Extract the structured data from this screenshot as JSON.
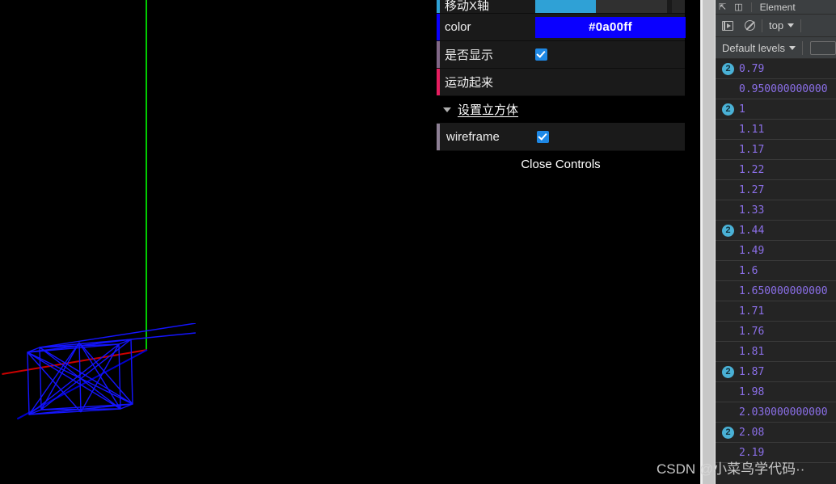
{
  "scene": {
    "background_color": "#000000",
    "axis_x_color": "#cc0000",
    "axis_y_color": "#00cc00",
    "axis_z_color": "#0000cc",
    "cube_wireframe_color": "#1414ff"
  },
  "gui": {
    "rows": [
      {
        "label": "移动X轴",
        "type": "slider",
        "value": "2.14",
        "fill_percent": 46,
        "marker_color": "#2fa1d6"
      },
      {
        "label": "color",
        "type": "color",
        "value": "#0a00ff",
        "marker_color": "#0a00ff"
      },
      {
        "label": "是否显示",
        "type": "checkbox",
        "checked": true,
        "marker_color": "#806787"
      },
      {
        "label": "运动起来",
        "type": "button",
        "marker_color": "#e61d5f"
      }
    ],
    "folder": {
      "title": "设置立方体",
      "expanded": true,
      "rows": [
        {
          "label": "wireframe",
          "type": "checkbox",
          "checked": true,
          "marker_color": "#8d7f94"
        }
      ]
    },
    "close_label": "Close Controls"
  },
  "devtools": {
    "tabbar": {
      "cursor_icon": "inspect-element-icon",
      "device_icon": "device-toolbar-icon",
      "tab_label": "Element"
    },
    "toolbar": {
      "sidebar_icon": "console-sidebar-icon",
      "clear_icon": "clear-console-icon",
      "context_value": "top"
    },
    "filterbar": {
      "levels_value": "Default levels",
      "filter_value": "",
      "filter_placeholder": ""
    },
    "console_entries": [
      {
        "count": "2",
        "value": "0.79"
      },
      {
        "count": "",
        "value": "0.950000000000"
      },
      {
        "count": "2",
        "value": "1"
      },
      {
        "count": "",
        "value": "1.11"
      },
      {
        "count": "",
        "value": "1.17"
      },
      {
        "count": "",
        "value": "1.22"
      },
      {
        "count": "",
        "value": "1.27"
      },
      {
        "count": "",
        "value": "1.33"
      },
      {
        "count": "2",
        "value": "1.44"
      },
      {
        "count": "",
        "value": "1.49"
      },
      {
        "count": "",
        "value": "1.6"
      },
      {
        "count": "",
        "value": "1.650000000000"
      },
      {
        "count": "",
        "value": "1.71"
      },
      {
        "count": "",
        "value": "1.76"
      },
      {
        "count": "",
        "value": "1.81"
      },
      {
        "count": "2",
        "value": "1.87"
      },
      {
        "count": "",
        "value": "1.98"
      },
      {
        "count": "",
        "value": "2.030000000000"
      },
      {
        "count": "2",
        "value": "2.08"
      },
      {
        "count": "",
        "value": "2.19"
      }
    ]
  },
  "watermark": {
    "text": "CSDN @小菜鸟学代码··"
  }
}
